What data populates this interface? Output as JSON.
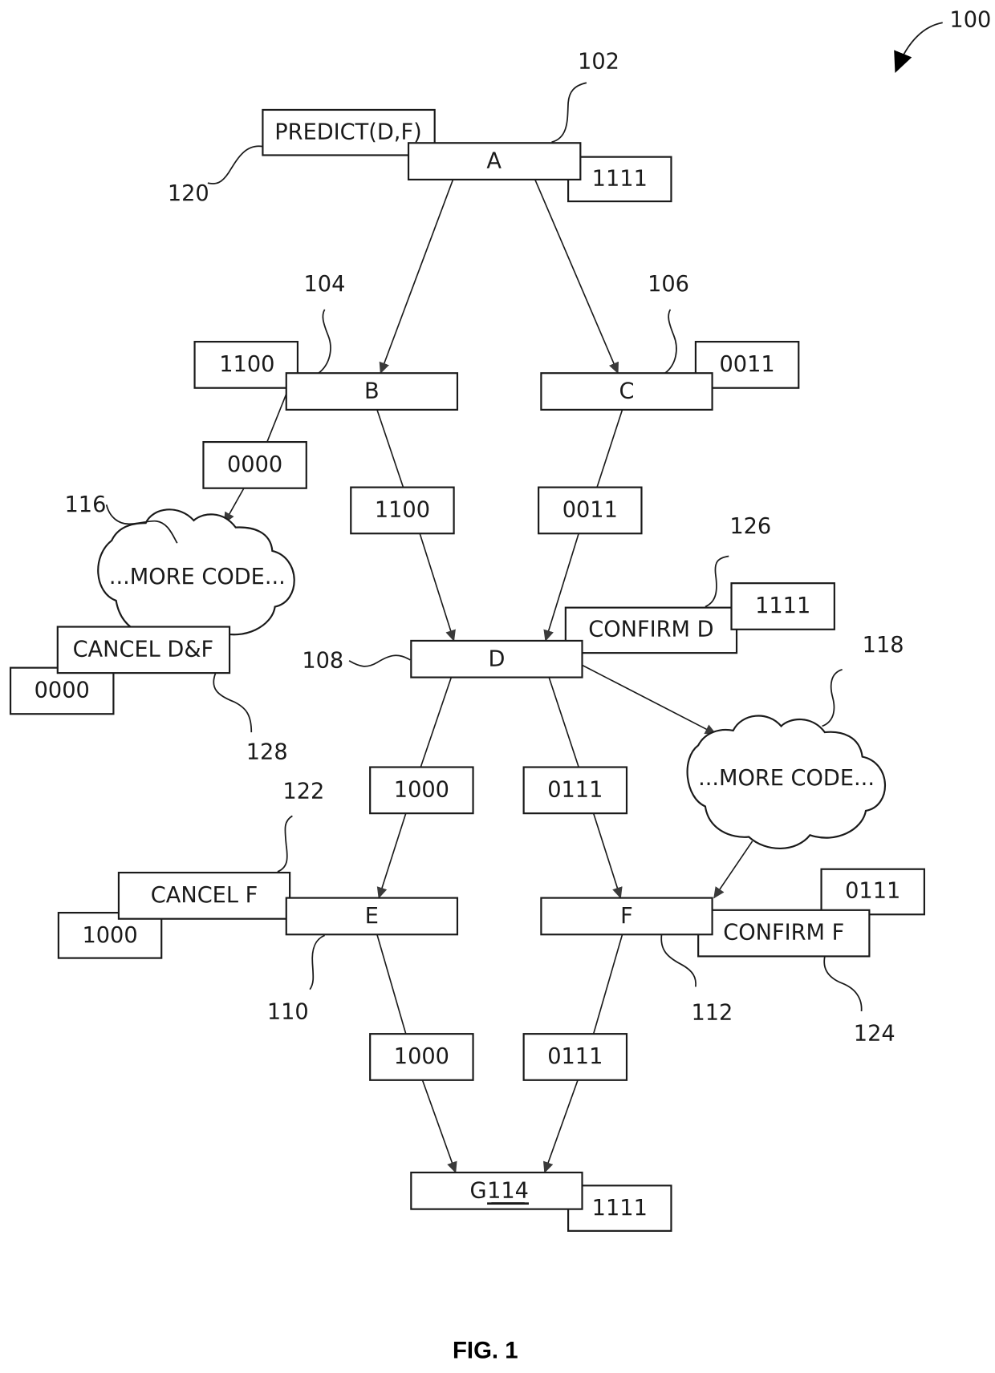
{
  "figure": {
    "caption": "FIG. 1",
    "ref": "100"
  },
  "nodes": {
    "a": {
      "label": "A",
      "ref": "102",
      "mask": "1111"
    },
    "b": {
      "label": "B",
      "ref": "104",
      "mask": "1100"
    },
    "c": {
      "label": "C",
      "ref": "106",
      "mask": "0011"
    },
    "d": {
      "label": "D",
      "ref": "108"
    },
    "e": {
      "label": "E",
      "ref": "110",
      "mask": "1000"
    },
    "f": {
      "label": "F",
      "ref": "112",
      "mask": "0111"
    },
    "g": {
      "label": "G",
      "ref": "114",
      "mask": "1111"
    }
  },
  "annotations": {
    "predict": {
      "label": "PREDICT(D,F)",
      "ref": "120"
    },
    "confirm_d": {
      "label": "CONFIRM D",
      "ref": "126",
      "mask": "1111"
    },
    "cancel_df": {
      "label": "CANCEL D&F",
      "ref": "128",
      "mask": "0000"
    },
    "cancel_f": {
      "label": "CANCEL F",
      "ref": "122"
    },
    "confirm_f": {
      "label": "CONFIRM F",
      "ref": "124"
    }
  },
  "clouds": {
    "left": {
      "label": "...MORE CODE...",
      "ref": "116"
    },
    "right": {
      "label": "...MORE CODE...",
      "ref": "118"
    }
  },
  "edge_labels": {
    "b_to_cloud": "0000",
    "b_to_d": "1100",
    "c_to_d": "0011",
    "d_to_e": "1000",
    "d_to_f": "0111",
    "e_to_g": "1000",
    "f_to_g": "0111"
  }
}
